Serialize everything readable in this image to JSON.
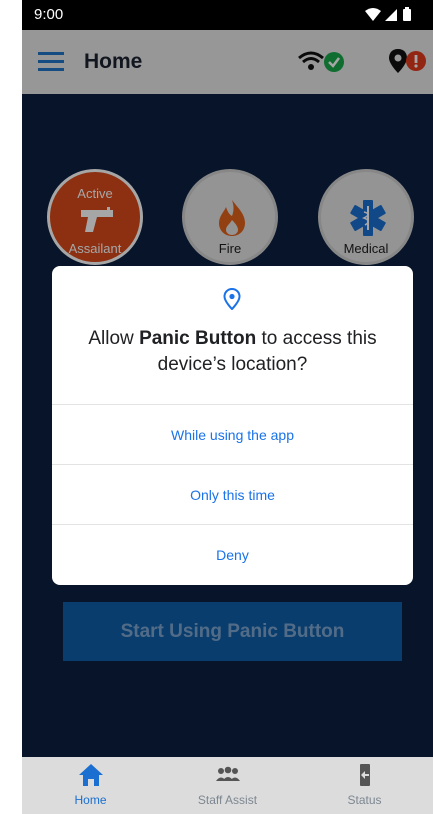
{
  "status_bar": {
    "time": "9:00",
    "icons": [
      "wifi-icon",
      "signal-icon",
      "battery-icon"
    ]
  },
  "app_bar": {
    "title": "Home",
    "icons": [
      "menu-icon",
      "wifi-icon",
      "check-icon",
      "location-pin-icon",
      "alert-icon"
    ]
  },
  "emergency_buttons": [
    {
      "top": "Active",
      "bottom": "Assailant",
      "icon": "gun-icon"
    },
    {
      "top": "",
      "bottom": "Fire",
      "icon": "fire-icon"
    },
    {
      "top": "",
      "bottom": "Medical",
      "icon": "medical-icon"
    }
  ],
  "start_button": {
    "label": "Start Using Panic Button"
  },
  "dialog": {
    "prefix": "Allow ",
    "app_name": "Panic Button",
    "suffix": " to access this device’s location?",
    "options": [
      "While using the app",
      "Only this time",
      "Deny"
    ]
  },
  "bottom_nav": [
    {
      "label": "Home",
      "icon": "home-icon",
      "active": true
    },
    {
      "label": "Staff Assist",
      "icon": "staff-assist-icon",
      "active": false
    },
    {
      "label": "Status",
      "icon": "status-icon",
      "active": false
    }
  ],
  "colors": {
    "background": "#0b1f3f",
    "accent": "#1a73e8",
    "active_assailant": "#d84a1b",
    "start_button": "#0f5fa8",
    "check_green": "#18a84a",
    "alert_red": "#e23b1c"
  }
}
